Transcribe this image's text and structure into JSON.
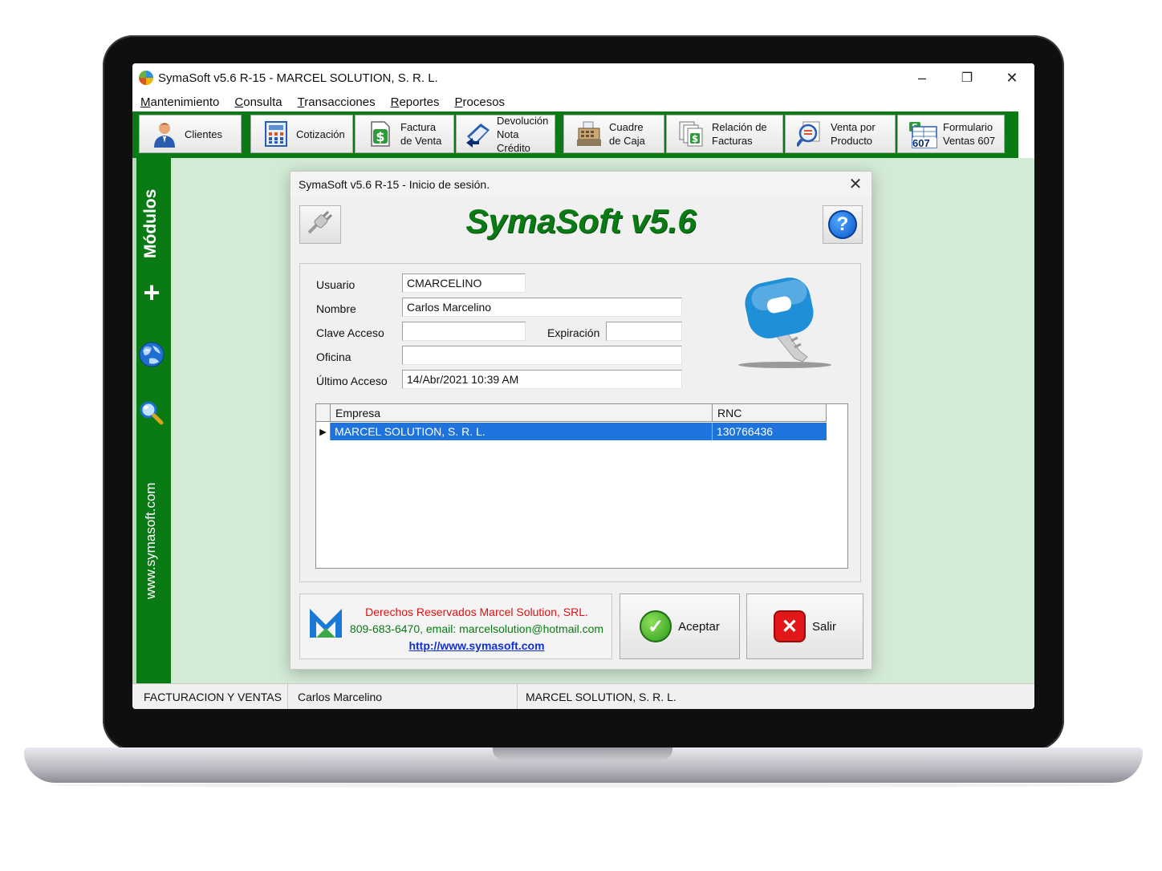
{
  "window": {
    "title": "SymaSoft v5.6  R-15 - MARCEL SOLUTION, S. R. L.",
    "minimize": "–",
    "maximize": "❐",
    "close": "✕"
  },
  "menu": [
    {
      "first": "M",
      "rest": "antenimiento"
    },
    {
      "first": "C",
      "rest": "onsulta"
    },
    {
      "first": "T",
      "rest": "ransacciones"
    },
    {
      "first": "R",
      "rest": "eportes"
    },
    {
      "first": "P",
      "rest": "rocesos"
    }
  ],
  "toolbar": {
    "items": [
      {
        "label": "Clientes",
        "icon": "person-icon"
      },
      {
        "label": "Cotización",
        "icon": "calculator-icon"
      },
      {
        "label": "Factura\nde Venta",
        "icon": "invoice-dollar-icon"
      },
      {
        "label": "Devolución\nNota Crédito",
        "icon": "return-book-icon"
      },
      {
        "label": "Cuadre\nde Caja",
        "icon": "cash-register-icon"
      },
      {
        "label": "Relación de\nFacturas",
        "icon": "invoices-list-icon"
      },
      {
        "label": "Venta por\nProducto",
        "icon": "magnifier-report-icon"
      },
      {
        "label": "Formulario\nVentas 607",
        "icon": "form-607-icon"
      }
    ],
    "badge_607": "607"
  },
  "sidebar": {
    "modules": "Módulos",
    "plus": "+",
    "website": "www.symasoft.com"
  },
  "dialog": {
    "title": "SymaSoft v5.6  R-15 - Inicio de sesión.",
    "close": "✕",
    "brand": "SymaSoft v5.6",
    "help": "?",
    "labels": {
      "usuario": "Usuario",
      "nombre": "Nombre",
      "clave": "Clave Acceso",
      "expiracion": "Expiración",
      "oficina": "Oficina",
      "ultimo": "Último Acceso"
    },
    "values": {
      "usuario": "CMARCELINO",
      "nombre": "Carlos Marcelino",
      "clave": "",
      "expiracion": "",
      "oficina": "",
      "ultimo": "14/Abr/2021 10:39 AM"
    },
    "grid": {
      "columns": [
        "Empresa",
        "RNC"
      ],
      "rows": [
        {
          "empresa": "MARCEL SOLUTION, S. R. L.",
          "rnc": "130766436"
        }
      ],
      "row_marker": "▶"
    },
    "footer": {
      "line1": "Derechos Reservados Marcel Solution, SRL.",
      "line2": "809-683-6470, email: marcelsolution@hotmail.com",
      "link": "http://www.symasoft.com"
    },
    "accept": "Aceptar",
    "exit": "Salir"
  },
  "status": {
    "module": "FACTURACION Y VENTAS",
    "user": "Carlos Marcelino",
    "company": "MARCEL SOLUTION, S. R. L."
  },
  "colors": {
    "brand_green": "#0a7a14",
    "background_green": "#d3ead5",
    "selection_blue": "#1e73dc",
    "copyright_red": "#e01010",
    "footer_green": "#0a7a14",
    "link_blue": "#1030d0"
  }
}
